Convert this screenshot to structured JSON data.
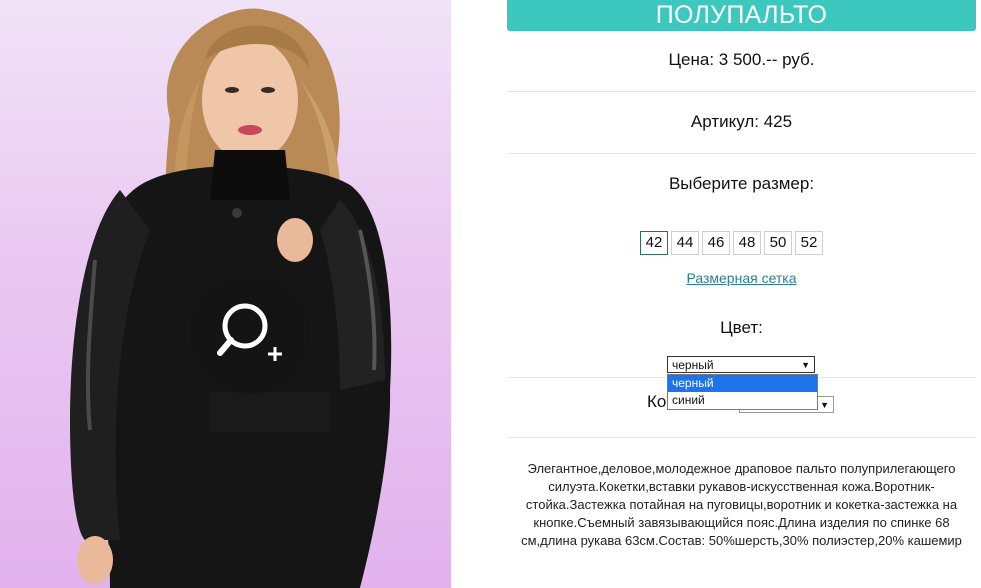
{
  "product": {
    "title": "ПОЛУПАЛЬТО",
    "price": "Цена: 3 500.-- руб.",
    "article": "Артикул: 425",
    "choose_size": "Выберите размер:",
    "sizes": [
      "42",
      "44",
      "46",
      "48",
      "50",
      "52"
    ],
    "selected_size": "42",
    "size_chart_link": "Размерная сетка",
    "color_label": "Цвет:",
    "color_selected": "черный",
    "color_options": [
      "черный",
      "синий"
    ],
    "quantity_label_partial": "Ко",
    "description": "Элегантное,деловое,молодежное драповое пальто полуприлегающего силуэта.Кокетки,вставки рукавов-искусственная кожа.Воротник-стойка.Застежка потайная на пуговицы,воротник и кокетка-застежка на кнопке.Съемный завязывающийся пояс.Длина изделия по спинке 68 см,длина рукава 63см.Состав: 50%шерсть,30% полиэстер,20% кашемир"
  },
  "colors": {
    "accent": "#3cc7bf",
    "link": "#2a7f96",
    "highlight": "#1e73e8"
  },
  "icons": {
    "zoom": "zoom-in-icon",
    "dropdown": "chevron-down-icon"
  }
}
